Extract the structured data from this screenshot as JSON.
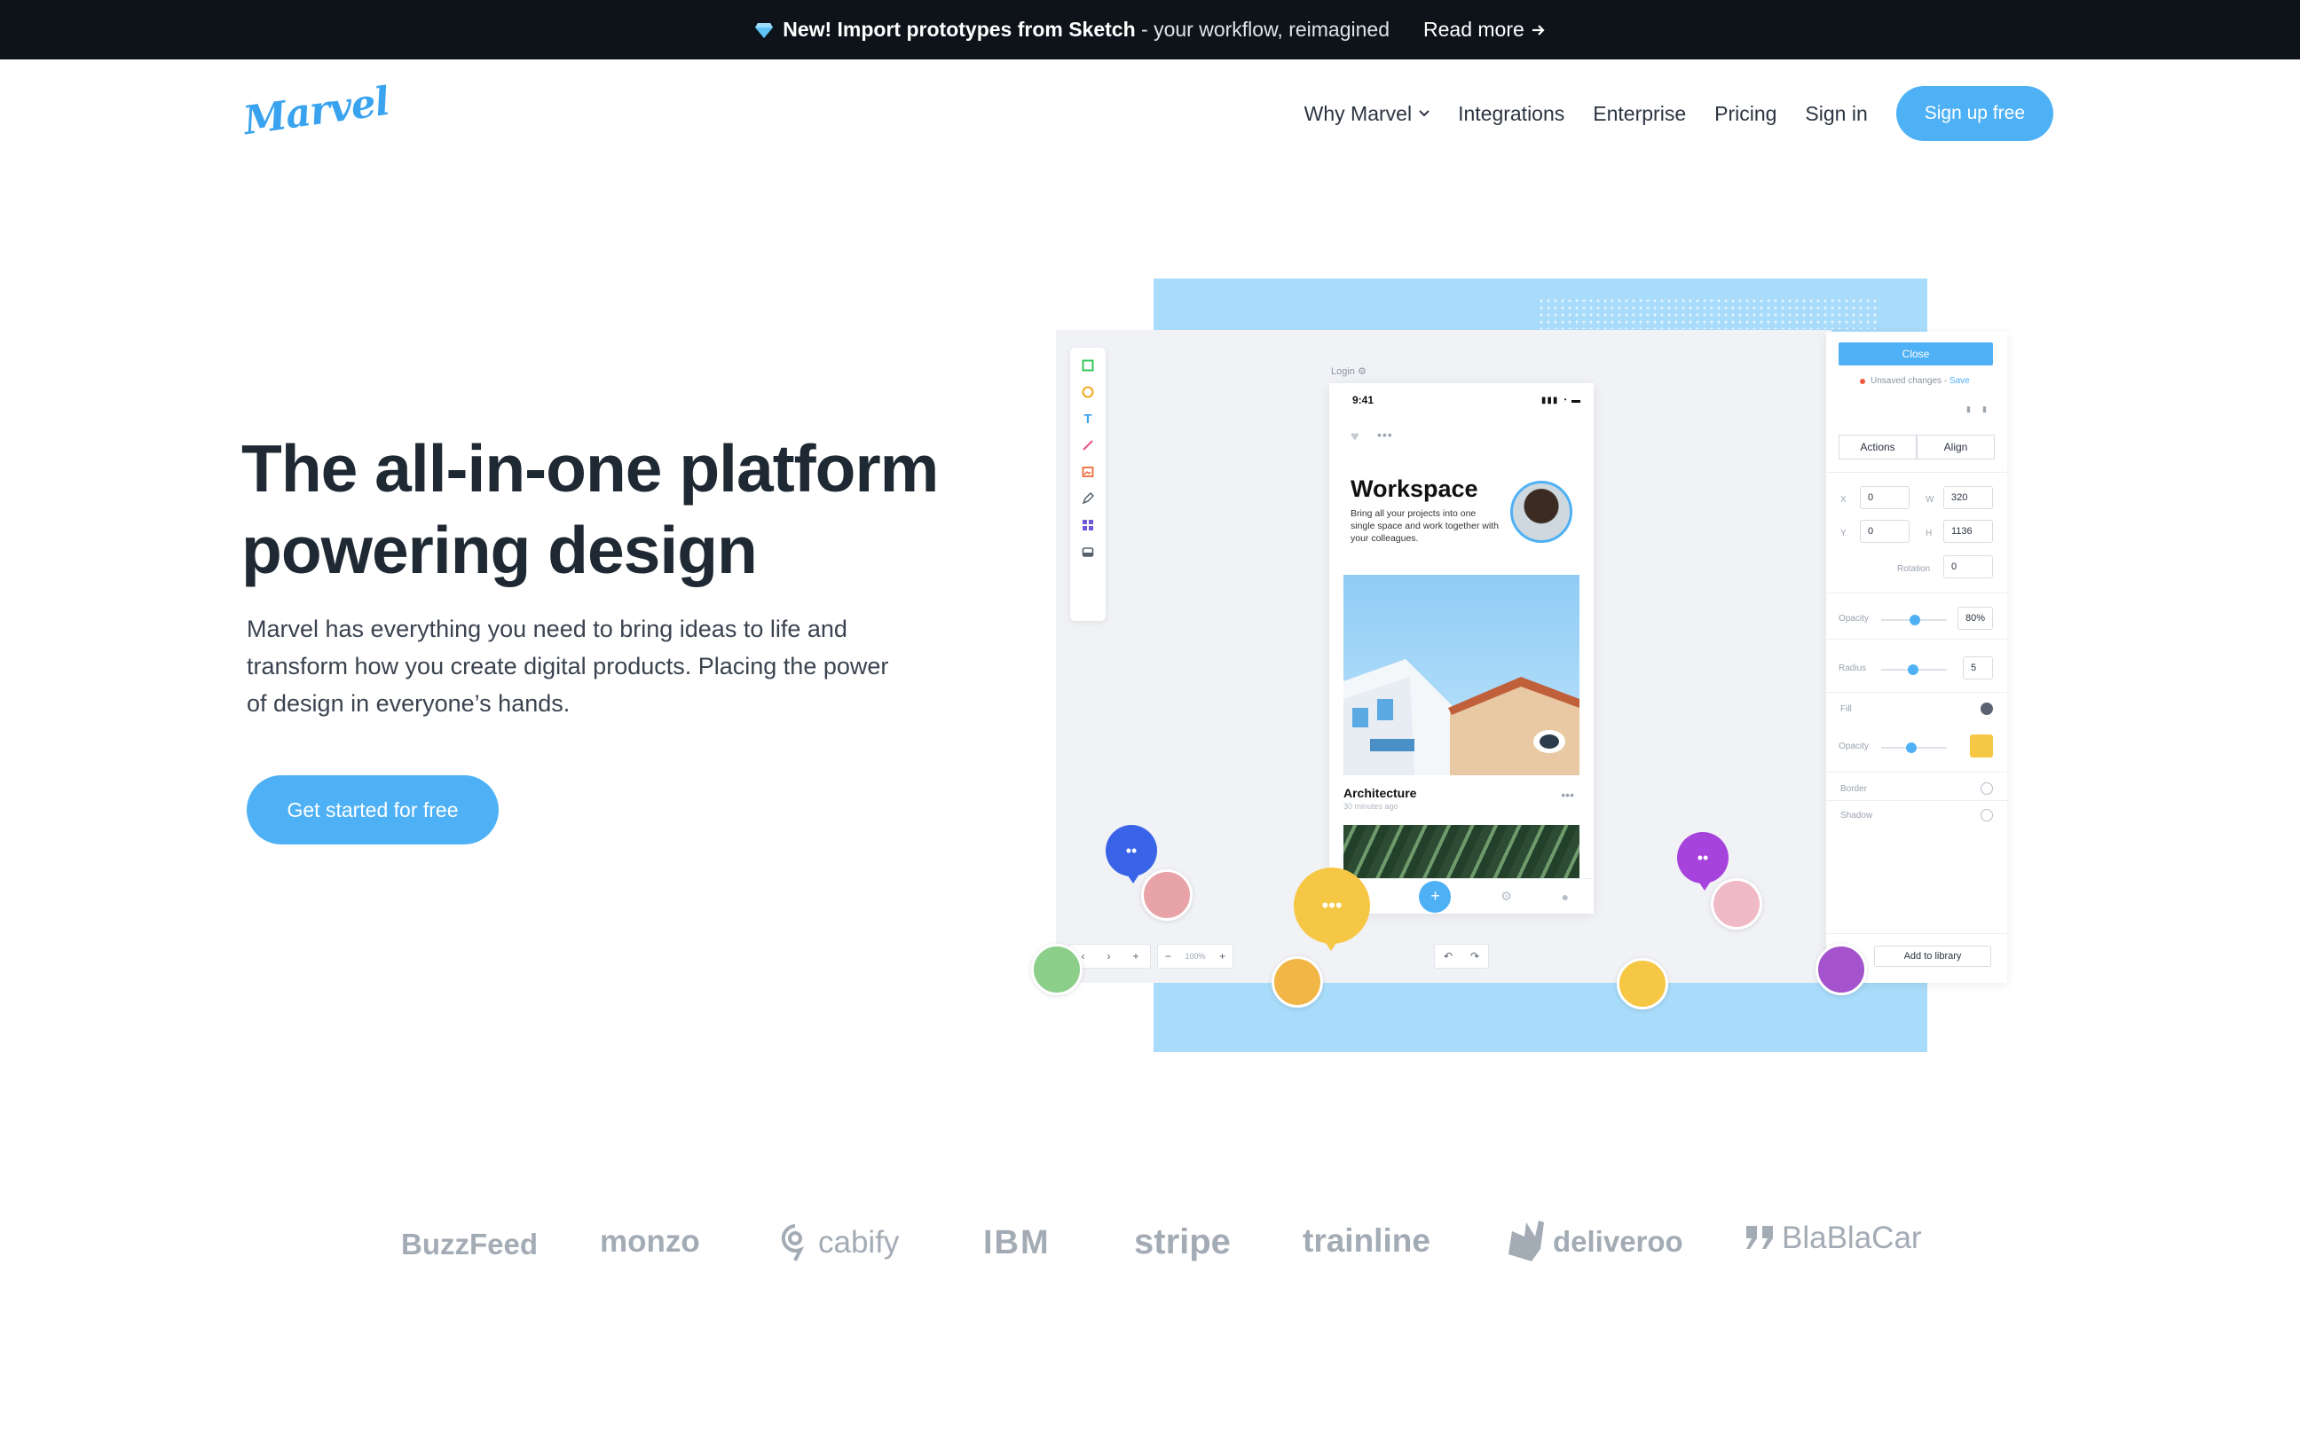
{
  "banner": {
    "headline": "New! Import prototypes from Sketch",
    "separator": " - ",
    "tagline": "your workflow, reimagined",
    "read_more": "Read more"
  },
  "header": {
    "logo": "Marvel",
    "nav": [
      "Why Marvel",
      "Integrations",
      "Enterprise",
      "Pricing",
      "Sign in"
    ],
    "signup": "Sign up free"
  },
  "hero": {
    "title_line1": "The all-in-one platform",
    "title_line2": "powering design",
    "subtitle": "Marvel has everything you need to bring ideas to life and transform how you create digital products. Placing the power of design in everyone’s hands.",
    "cta": "Get started for free"
  },
  "mockup": {
    "login_label": "Login",
    "phone": {
      "time": "9:41",
      "title": "Workspace",
      "description": "Bring all your projects into one single space and work together with your colleagues.",
      "card_title": "Architecture",
      "card_sub": "30 minutes ago"
    },
    "panel": {
      "close": "Close",
      "unsaved": "Unsaved changes - ",
      "save": "Save",
      "tabs": [
        "Actions",
        "Align"
      ],
      "x_label": "X",
      "x": "0",
      "y_label": "Y",
      "y": "0",
      "w_label": "W",
      "w": "320",
      "h_label": "H",
      "h": "1136",
      "rotation_label": "Rotation",
      "rotation": "0",
      "opacity_label": "Opacity",
      "opacity": "80%",
      "radius_label": "Radius",
      "radius": "5",
      "fill_label": "Fill",
      "fill_opacity_label": "Opacity",
      "border_label": "Border",
      "shadow_label": "Shadow",
      "add_to_library": "Add to library",
      "fill_color": "#f6c744"
    },
    "zoom": "100%"
  },
  "clients": [
    "BuzzFeed",
    "monzo",
    "cabify",
    "IBM",
    "stripe",
    "trainline",
    "deliveroo",
    "BlaBlaCar"
  ],
  "colors": {
    "accent": "#4fb1f5",
    "dark": "#0e131a",
    "title": "#1f2933",
    "logo_gray": "#a3abb5"
  }
}
